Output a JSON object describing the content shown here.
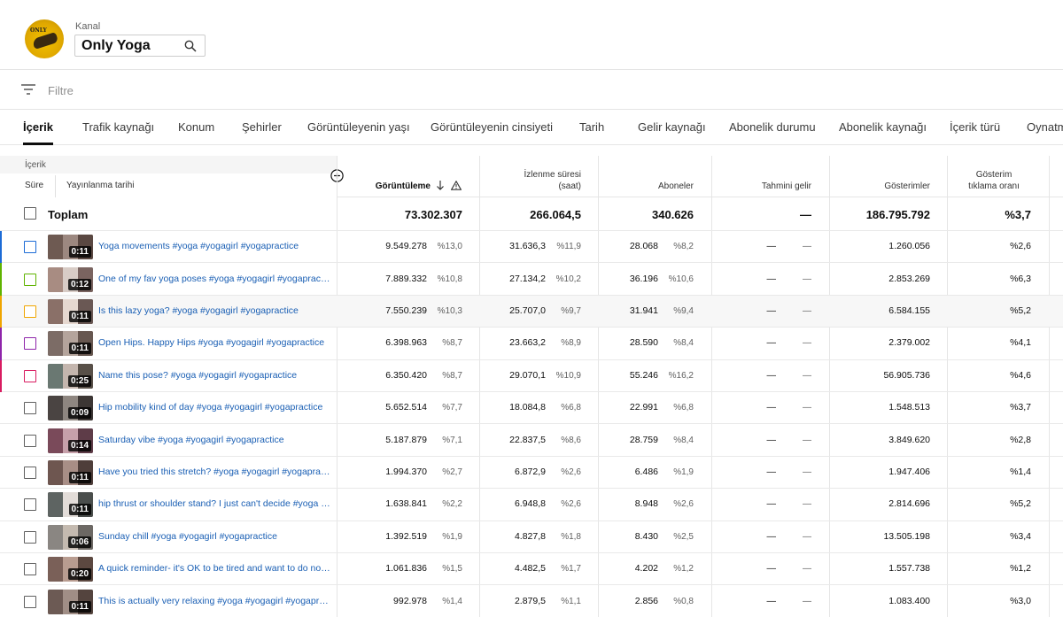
{
  "header": {
    "channel_label": "Kanal",
    "channel_name": "Only Yoga",
    "avatar_text": "ONLY"
  },
  "filter": {
    "label": "Filtre"
  },
  "tabs": [
    {
      "label": "İçerik",
      "active": true
    },
    {
      "label": "Trafik kaynağı"
    },
    {
      "label": "Konum"
    },
    {
      "label": "Şehirler"
    },
    {
      "label": "Görüntüleyenin yaşı"
    },
    {
      "label": "Görüntüleyenin cinsiyeti"
    },
    {
      "label": "Tarih"
    },
    {
      "label": "Gelir kaynağı"
    },
    {
      "label": "Abonelik durumu"
    },
    {
      "label": "Abonelik kaynağı"
    },
    {
      "label": "İçerik türü"
    },
    {
      "label": "Oynatma"
    }
  ],
  "table": {
    "group_label": "İçerik",
    "col_duration": "Süre",
    "col_published": "Yayınlanma tarihi",
    "headers": {
      "views": "Görüntüleme",
      "watch_1": "İzlenme süresi",
      "watch_2": "(saat)",
      "subs": "Aboneler",
      "revenue": "Tahmini gelir",
      "impressions": "Gösterimler",
      "ctr_1": "Gösterim",
      "ctr_2": "tıklama oranı"
    },
    "total": {
      "label": "Toplam",
      "views": "73.302.307",
      "watch": "266.064,5",
      "subs": "340.626",
      "revenue": "—",
      "impressions": "186.795.792",
      "ctr": "%3,7"
    },
    "rows": [
      {
        "title": "Yoga movements #yoga #yogagirl #yogapractice",
        "duration": "0:11",
        "views": "9.549.278",
        "views_pct": "%13,0",
        "watch": "31.636,3",
        "watch_pct": "%11,9",
        "subs": "28.068",
        "subs_pct": "%8,2",
        "rev": "—",
        "rev_pct": "—",
        "impr": "1.260.056",
        "ctr": "%2,6",
        "color": "#1c6bd6"
      },
      {
        "title": "One of my fav yoga poses #yoga #yogagirl #yogapractice",
        "duration": "0:12",
        "views": "7.889.332",
        "views_pct": "%10,8",
        "watch": "27.134,2",
        "watch_pct": "%10,2",
        "subs": "36.196",
        "subs_pct": "%10,6",
        "rev": "—",
        "rev_pct": "—",
        "impr": "2.853.269",
        "ctr": "%6,3",
        "color": "#5fb300"
      },
      {
        "title": "Is this lazy yoga? #yoga #yogagirl #yogapractice",
        "duration": "0:11",
        "views": "7.550.239",
        "views_pct": "%10,3",
        "watch": "25.707,0",
        "watch_pct": "%9,7",
        "subs": "31.941",
        "subs_pct": "%9,4",
        "rev": "—",
        "rev_pct": "—",
        "impr": "6.584.155",
        "ctr": "%5,2",
        "color": "#f0a500"
      },
      {
        "title": "Open Hips. Happy Hips #yoga #yogagirl #yogapractice",
        "duration": "0:11",
        "views": "6.398.963",
        "views_pct": "%8,7",
        "watch": "23.663,2",
        "watch_pct": "%8,9",
        "subs": "28.590",
        "subs_pct": "%8,4",
        "rev": "—",
        "rev_pct": "—",
        "impr": "2.379.002",
        "ctr": "%4,1",
        "color": "#8e24aa"
      },
      {
        "title": "Name this pose? #yoga #yogagirl #yogapractice",
        "duration": "0:25",
        "views": "6.350.420",
        "views_pct": "%8,7",
        "watch": "29.070,1",
        "watch_pct": "%10,9",
        "subs": "55.246",
        "subs_pct": "%16,2",
        "rev": "—",
        "rev_pct": "—",
        "impr": "56.905.736",
        "ctr": "%4,6",
        "color": "#d81b60"
      },
      {
        "title": "Hip mobility kind of day #yoga #yogagirl #yogapractice",
        "duration": "0:09",
        "views": "5.652.514",
        "views_pct": "%7,7",
        "watch": "18.084,8",
        "watch_pct": "%6,8",
        "subs": "22.991",
        "subs_pct": "%6,8",
        "rev": "—",
        "rev_pct": "—",
        "impr": "1.548.513",
        "ctr": "%3,7"
      },
      {
        "title": "Saturday vibe #yoga #yogagirl #yogapractice",
        "duration": "0:14",
        "views": "5.187.879",
        "views_pct": "%7,1",
        "watch": "22.837,5",
        "watch_pct": "%8,6",
        "subs": "28.759",
        "subs_pct": "%8,4",
        "rev": "—",
        "rev_pct": "—",
        "impr": "3.849.620",
        "ctr": "%2,8"
      },
      {
        "title": "Have you tried this stretch? #yoga #yogagirl #yogapractice",
        "duration": "0:11",
        "views": "1.994.370",
        "views_pct": "%2,7",
        "watch": "6.872,9",
        "watch_pct": "%2,6",
        "subs": "6.486",
        "subs_pct": "%1,9",
        "rev": "—",
        "rev_pct": "—",
        "impr": "1.947.406",
        "ctr": "%1,4"
      },
      {
        "title": "hip thrust or shoulder stand? I just can't decide #yoga #yogagirl",
        "duration": "0:11",
        "views": "1.638.841",
        "views_pct": "%2,2",
        "watch": "6.948,8",
        "watch_pct": "%2,6",
        "subs": "8.948",
        "subs_pct": "%2,6",
        "rev": "—",
        "rev_pct": "—",
        "impr": "2.814.696",
        "ctr": "%5,2"
      },
      {
        "title": "Sunday chill #yoga #yogagirl #yogapractice",
        "duration": "0:06",
        "views": "1.392.519",
        "views_pct": "%1,9",
        "watch": "4.827,8",
        "watch_pct": "%1,8",
        "subs": "8.430",
        "subs_pct": "%2,5",
        "rev": "—",
        "rev_pct": "—",
        "impr": "13.505.198",
        "ctr": "%3,4"
      },
      {
        "title": "A quick reminder- it's OK to be tired and want to do nothing",
        "duration": "0:20",
        "views": "1.061.836",
        "views_pct": "%1,5",
        "watch": "4.482,5",
        "watch_pct": "%1,7",
        "subs": "4.202",
        "subs_pct": "%1,2",
        "rev": "—",
        "rev_pct": "—",
        "impr": "1.557.738",
        "ctr": "%1,2"
      },
      {
        "title": "This is actually very relaxing #yoga #yogagirl #yogapractice",
        "duration": "0:11",
        "views": "992.978",
        "views_pct": "%1,4",
        "watch": "2.879,5",
        "watch_pct": "%1,1",
        "subs": "2.856",
        "subs_pct": "%0,8",
        "rev": "—",
        "rev_pct": "—",
        "impr": "1.083.400",
        "ctr": "%3,0"
      }
    ]
  }
}
